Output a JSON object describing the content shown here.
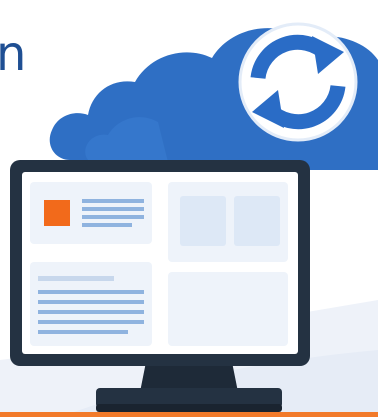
{
  "heading": {
    "visible_text": "n"
  },
  "illustration": {
    "cloud_icon": "cloud-icon",
    "sync_icon": "sync-arrows-icon",
    "monitor_icon": "computer-monitor-icon",
    "colors": {
      "cloud": "#2f6fc4",
      "cloud_light": "#3b7dd3",
      "sync_arrows": "#2a6cc6",
      "monitor_frame": "#243242",
      "screen_panel": "#eef3fa",
      "screen_tile": "#dde8f6",
      "accent_square": "#f26a1b",
      "text_lines": "#8fb3df",
      "floor_accent": "#f27a2a"
    }
  }
}
